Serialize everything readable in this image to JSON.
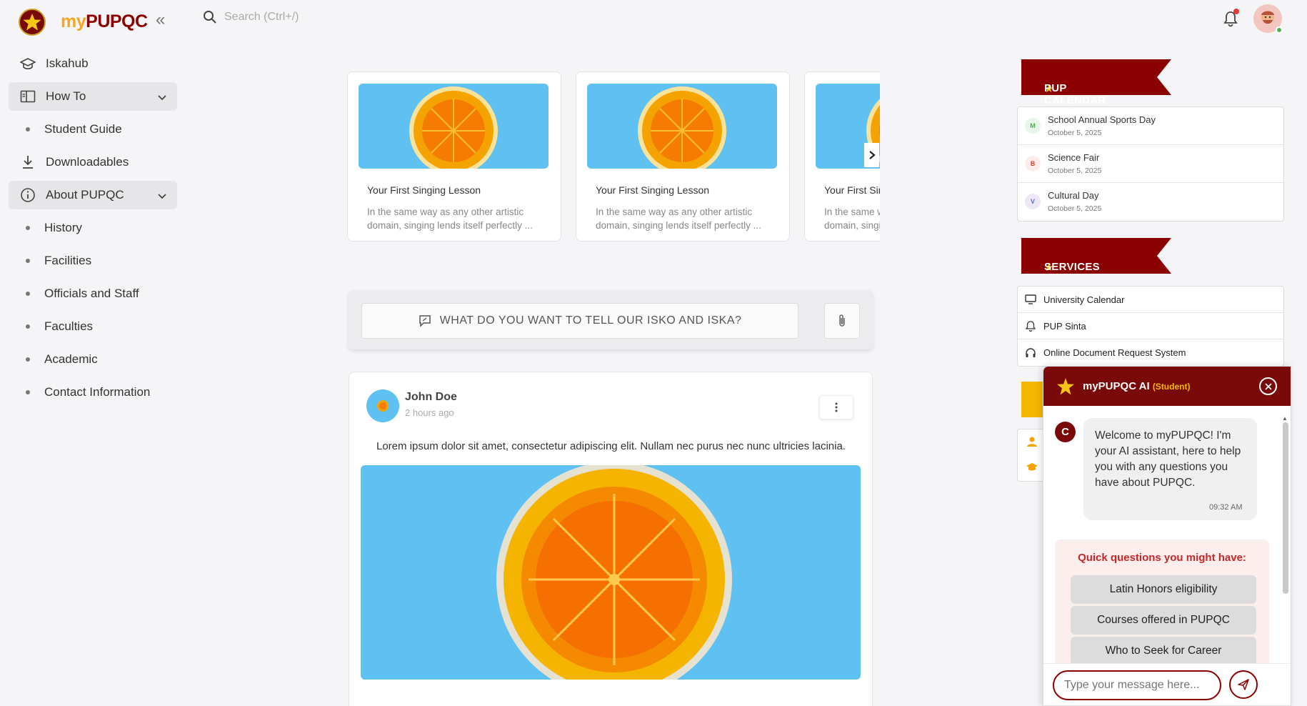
{
  "header": {
    "brand_prefix": "my",
    "brand_name": "PUPQC",
    "search_placeholder": "Search (Ctrl+/)"
  },
  "sidebar": {
    "items": [
      {
        "label": "Iskahub",
        "icon": "graduation-cap-icon"
      },
      {
        "label": "How To",
        "icon": "book-icon",
        "expanded": true
      },
      {
        "label": "Student Guide"
      },
      {
        "label": "Downloadables",
        "icon": "download-icon"
      },
      {
        "label": "About PUPQC",
        "icon": "info-icon",
        "expanded": true
      },
      {
        "label": "History"
      },
      {
        "label": "Facilities"
      },
      {
        "label": "Officials and Staff"
      },
      {
        "label": "Faculties"
      },
      {
        "label": "Academic"
      },
      {
        "label": "Contact Information"
      }
    ]
  },
  "carousel": {
    "cards": [
      {
        "title": "Your First Singing Lesson",
        "desc": "In the same way as any other artistic domain, singing lends itself perfectly ..."
      },
      {
        "title": "Your First Singing Lesson",
        "desc": "In the same way as any other artistic domain, singing lends itself perfectly ..."
      },
      {
        "title": "Your First Singing Lesson",
        "desc": "In the same way as any other artistic domain, singing lends itself perfectly ..."
      }
    ]
  },
  "composer": {
    "prompt": "WHAT DO YOU WANT TO TELL OUR ISKO AND ISKA?"
  },
  "post": {
    "author": "John Doe",
    "time": "2 hours ago",
    "text": "Lorem ipsum dolor sit amet, consectetur adipiscing elit. Nullam nec purus nec nunc ultricies lacinia."
  },
  "calendar": {
    "title": "PUP CALENDAR",
    "events": [
      {
        "badge": "M",
        "title": "School Annual Sports Day",
        "date": "October 5, 2025",
        "color": "#4caf50",
        "bg": "#e8f5e9"
      },
      {
        "badge": "B",
        "title": "Science Fair",
        "date": "October 5, 2025",
        "color": "#e53935",
        "bg": "#fdecea"
      },
      {
        "badge": "V",
        "title": "Cultural Day",
        "date": "October 5, 2025",
        "color": "#5c6bc0",
        "bg": "#ede7f6"
      }
    ]
  },
  "services": {
    "title": "SERVICES",
    "items": [
      {
        "label": "University Calendar",
        "icon": "monitor-icon"
      },
      {
        "label": "PUP Sinta",
        "icon": "bell-icon"
      },
      {
        "label": "Online Document Request System",
        "icon": "headphones-icon"
      }
    ]
  },
  "chat": {
    "title": "myPUPQC AI",
    "role": "(Student)",
    "bot_initial": "C",
    "welcome": "Welcome to myPUPQC! I'm your AI assistant, here to help you with any questions you have about PUPQC.",
    "time": "09:32 AM",
    "quick_title": "Quick questions you might have:",
    "quick": [
      "Latin Honors eligibility",
      "Courses offered in PUPQC",
      "Who to Seek for Career"
    ],
    "input_placeholder": "Type your message here..."
  },
  "colors": {
    "brand_maroon": "#7a0a0a",
    "brand_gold": "#f5a623",
    "sky": "#5fc1f1"
  }
}
